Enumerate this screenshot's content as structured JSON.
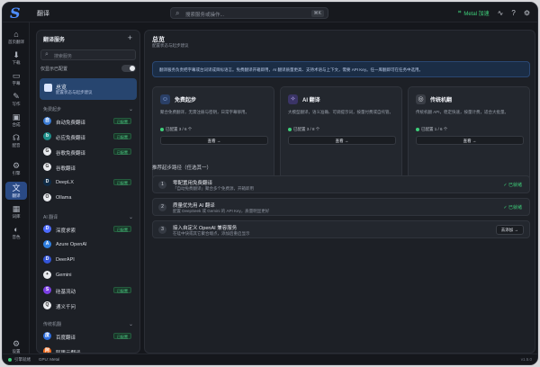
{
  "app": {
    "logo": "S",
    "title": "翻译"
  },
  "search": {
    "placeholder": "搜索服务或操作...",
    "shortcut": "⌘K"
  },
  "toolbar": {
    "metal_label": "Metal 加速"
  },
  "rail": [
    {
      "icon": "⌂",
      "label": "首页翻译"
    },
    {
      "icon": "⬇",
      "label": "下载"
    },
    {
      "icon": "▭",
      "label": "字幕"
    },
    {
      "icon": "✎",
      "label": "写作"
    },
    {
      "icon": "▣",
      "label": "合成"
    },
    {
      "icon": "☊",
      "label": "配音"
    },
    {
      "icon": "⚙",
      "label": "引擎"
    },
    {
      "icon": "文",
      "label": "翻译"
    },
    {
      "icon": "▦",
      "label": "词库"
    },
    {
      "icon": "◐",
      "label": "音色"
    },
    {
      "icon": "⚙",
      "label": "设置"
    }
  ],
  "panel": {
    "title": "翻译服务",
    "search_placeholder": "搜索服务",
    "toggle_label": "仅显示已配置",
    "overview": {
      "title": "总览",
      "subtitle": "配置状态与起步建议"
    },
    "groups": {
      "free": "免费起步",
      "ai": "AI 翻译",
      "traditional": "传统机翻"
    },
    "free_items": [
      {
        "name": "自动免费翻译",
        "badge": "已配置",
        "color": "#3a7bd5",
        "letter": "自"
      },
      {
        "name": "必应免费翻译",
        "badge": "已配置",
        "color": "#1f8f8a",
        "letter": "b"
      },
      {
        "name": "谷歌免费翻译",
        "badge": "已配置",
        "color": "#e8eaee",
        "letter": "G"
      },
      {
        "name": "谷歌翻译",
        "badge": "",
        "color": "#e8eaee",
        "letter": "G"
      },
      {
        "name": "DeepLX",
        "badge": "已配置",
        "color": "#0f2b46",
        "letter": "D"
      },
      {
        "name": "Ollama",
        "badge": "",
        "color": "#e8eaee",
        "letter": "O"
      }
    ],
    "ai_items": [
      {
        "name": "深度求索",
        "badge": "已配置",
        "color": "#4d6bfe",
        "letter": "D"
      },
      {
        "name": "Azure OpenAI",
        "badge": "",
        "color": "#2f7fe0",
        "letter": "A"
      },
      {
        "name": "DeerAPI",
        "badge": "",
        "color": "#3355d8",
        "letter": "D"
      },
      {
        "name": "Gemini",
        "badge": "",
        "color": "#e8eaee",
        "letter": "✦"
      },
      {
        "name": "硅基流动",
        "badge": "已配置",
        "color": "#7b3fe4",
        "letter": "S"
      },
      {
        "name": "通义千问",
        "badge": "",
        "color": "#e8eaee",
        "letter": "Q"
      }
    ],
    "trad_items": [
      {
        "name": "百度翻译",
        "badge": "已配置",
        "color": "#2f6fe0",
        "letter": "度"
      },
      {
        "name": "阿里云翻译",
        "badge": "",
        "color": "#f26b1d",
        "letter": "阿"
      }
    ]
  },
  "main": {
    "title": "总览",
    "subtitle": "配置状态与起步建议",
    "info": "翻译服务负责把字幕或台词译成目标语言。免费翻译开箱即用，AI 翻译质量更高、支持术语与上下文，需要 API Key。任一库翻即可在任务中选用。",
    "cards": [
      {
        "icon": "☺",
        "title": "免费起步",
        "desc": "聚合免费翻译，无需注册与密钥，日常字幕够用。",
        "status": "已配置 3 / 6 个",
        "button": "查看 →"
      },
      {
        "icon": "✧",
        "title": "AI 翻译",
        "desc": "大模型翻译，语义准确、可调提示词，按量付费或自托管。",
        "status": "已配置 3 / 8 个",
        "button": "查看 →"
      },
      {
        "icon": "◎",
        "title": "传统机翻",
        "desc": "传统机翻 API，稳定快速，按量计费，适合大批量。",
        "status": "已配置 1 / 6 个",
        "button": "查看 →"
      }
    ],
    "steps_title": "推荐起步路径（任选其一）",
    "steps": [
      {
        "num": "1",
        "title": "零配置用免费翻译",
        "desc": "「自动免费翻译」聚合多个免费源，开箱即用",
        "status": "✓ 已就绪",
        "action": ""
      },
      {
        "num": "2",
        "title": "质量优先用 AI 翻译",
        "desc": "配置 DeepSeek 或 Gemini 的 API Key，质量明显更好",
        "status": "✓ 已就绪",
        "action": ""
      },
      {
        "num": "3",
        "title": "接入自定义 OpenAI 兼容服务",
        "desc": "在硅中快或其它聚合端点，添加后重启显示",
        "status": "",
        "action": "去添加 →"
      }
    ]
  },
  "statusbar": {
    "left": "引擎就绪",
    "gpu": "GPU: Metal",
    "version": "v1.5.0"
  },
  "colors": {
    "accent": "#4e8dff",
    "success": "#3ecf7a",
    "background": "#15171c"
  }
}
